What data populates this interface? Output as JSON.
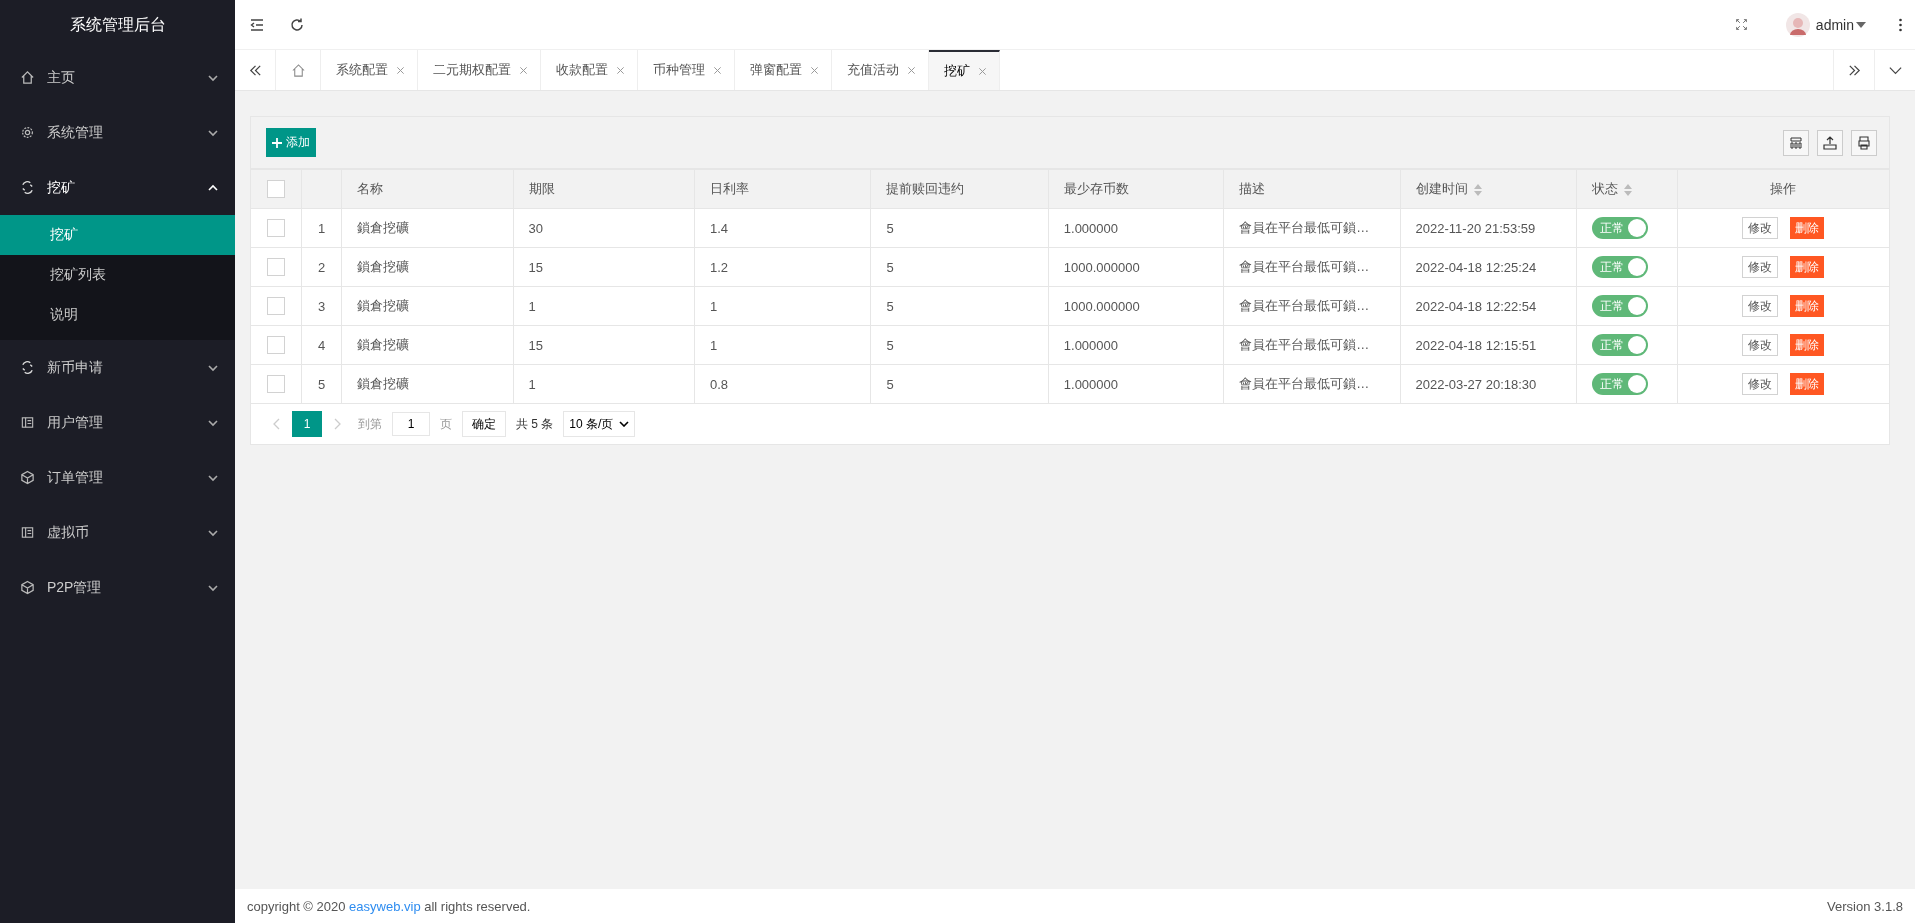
{
  "sidebar": {
    "title": "系统管理后台",
    "items": [
      {
        "label": "主页",
        "expanded": false
      },
      {
        "label": "系统管理",
        "expanded": false
      },
      {
        "label": "挖矿",
        "expanded": true,
        "children": [
          {
            "label": "挖矿",
            "selected": true
          },
          {
            "label": "挖矿列表",
            "selected": false
          },
          {
            "label": "说明",
            "selected": false
          }
        ]
      },
      {
        "label": "新币申请",
        "expanded": false
      },
      {
        "label": "用户管理",
        "expanded": false
      },
      {
        "label": "订单管理",
        "expanded": false
      },
      {
        "label": "虚拟币",
        "expanded": false
      },
      {
        "label": "P2P管理",
        "expanded": false
      }
    ]
  },
  "header": {
    "user": "admin"
  },
  "tabs": [
    {
      "label": "系统配置",
      "selected": false
    },
    {
      "label": "二元期权配置",
      "selected": false
    },
    {
      "label": "收款配置",
      "selected": false
    },
    {
      "label": "币种管理",
      "selected": false
    },
    {
      "label": "弹窗配置",
      "selected": false
    },
    {
      "label": "充值活动",
      "selected": false
    },
    {
      "label": "挖矿",
      "selected": true
    }
  ],
  "toolbar": {
    "add_button": "添加"
  },
  "table": {
    "select_all": {
      "checked": false
    },
    "columns": [
      "名称",
      "期限",
      "日利率",
      "提前赎回违约",
      "最少存币数",
      "描述",
      "创建时间",
      "状态",
      "操作"
    ],
    "rows": [
      {
        "index": "1",
        "name": "鎖倉挖礦",
        "term": "30",
        "daily_rate": "1.4",
        "penalty": "5",
        "min_coins": "1.000000",
        "description": "會員在平台最低可鎖…",
        "created": "2022-11-20 21:53:59",
        "status": "正常",
        "on": true,
        "checked": false,
        "edit": "修改",
        "delete": "删除"
      },
      {
        "index": "2",
        "name": "鎖倉挖礦",
        "term": "15",
        "daily_rate": "1.2",
        "penalty": "5",
        "min_coins": "1000.000000",
        "description": "會員在平台最低可鎖…",
        "created": "2022-04-18 12:25:24",
        "status": "正常",
        "on": true,
        "checked": false,
        "edit": "修改",
        "delete": "删除"
      },
      {
        "index": "3",
        "name": "鎖倉挖礦",
        "term": "1",
        "daily_rate": "1",
        "penalty": "5",
        "min_coins": "1000.000000",
        "description": "會員在平台最低可鎖…",
        "created": "2022-04-18 12:22:54",
        "status": "正常",
        "on": true,
        "checked": false,
        "edit": "修改",
        "delete": "删除"
      },
      {
        "index": "4",
        "name": "鎖倉挖礦",
        "term": "15",
        "daily_rate": "1",
        "penalty": "5",
        "min_coins": "1.000000",
        "description": "會員在平台最低可鎖…",
        "created": "2022-04-18 12:15:51",
        "status": "正常",
        "on": true,
        "checked": false,
        "edit": "修改",
        "delete": "删除"
      },
      {
        "index": "5",
        "name": "鎖倉挖礦",
        "term": "1",
        "daily_rate": "0.8",
        "penalty": "5",
        "min_coins": "1.000000",
        "description": "會員在平台最低可鎖…",
        "created": "2022-03-27 20:18:30",
        "status": "正常",
        "on": true,
        "checked": false,
        "edit": "修改",
        "delete": "删除"
      }
    ]
  },
  "pagination": {
    "pages": [
      {
        "label": "1",
        "selected": true
      }
    ],
    "goto_label": "到第",
    "goto_value": "1",
    "page_unit": "页",
    "confirm": "确定",
    "total": "共 5 条",
    "page_size": "10 条/页"
  },
  "footer": {
    "copyright_prefix": "copyright © 2020 ",
    "link": "easyweb.vip",
    "copyright_suffix": " all rights reserved.",
    "version": "Version 3.1.8"
  }
}
